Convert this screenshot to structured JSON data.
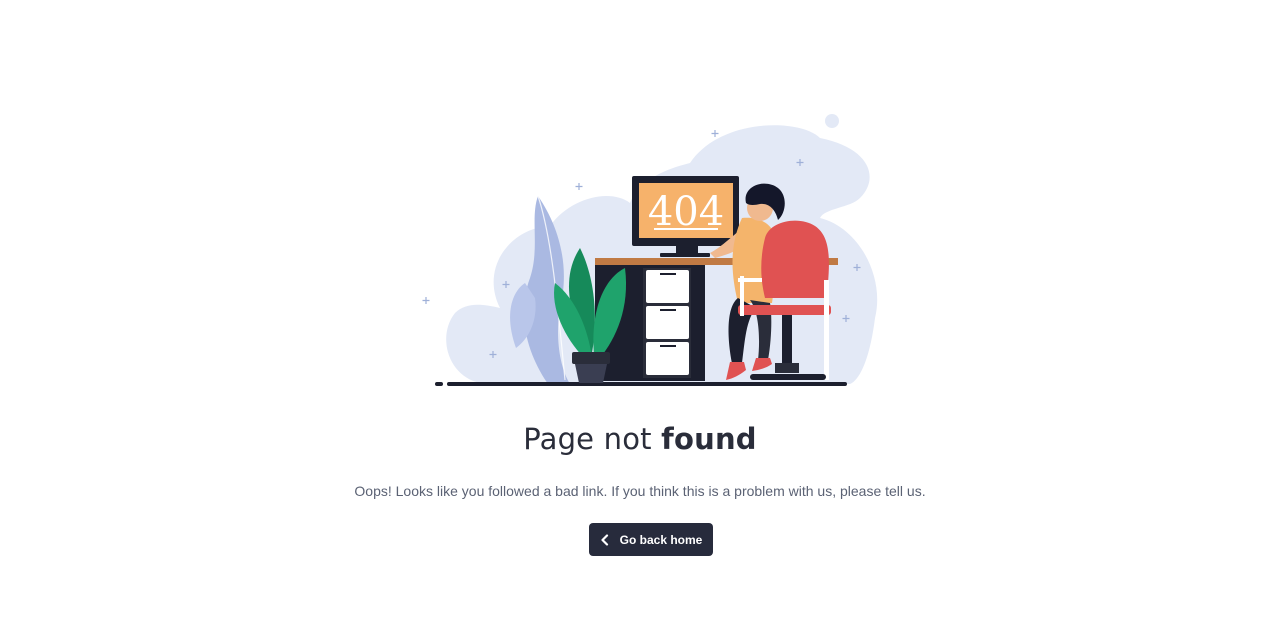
{
  "illustration": {
    "screen_text": "404",
    "colors": {
      "background_blob": "#e3e9f6",
      "screen": "#f6b26b",
      "monitor_frame": "#1c1f2e",
      "desk_top": "#c07a44",
      "chair": "#e05252",
      "plant_leaf": "#1fa36c",
      "plant_leaf_dark": "#168a5a",
      "fern": "#aab9e2",
      "shirt": "#f4b46b",
      "hair": "#14172a",
      "shoes": "#e05252",
      "floor": "#1c1f2e"
    }
  },
  "heading": {
    "normal": "Page not",
    "bold": "found"
  },
  "message": "Oops! Looks like you followed a bad link. If you think this is a problem with us, please tell us.",
  "button": {
    "label": "Go back home",
    "icon": "chevron-left-icon",
    "color": "#272b3c"
  }
}
